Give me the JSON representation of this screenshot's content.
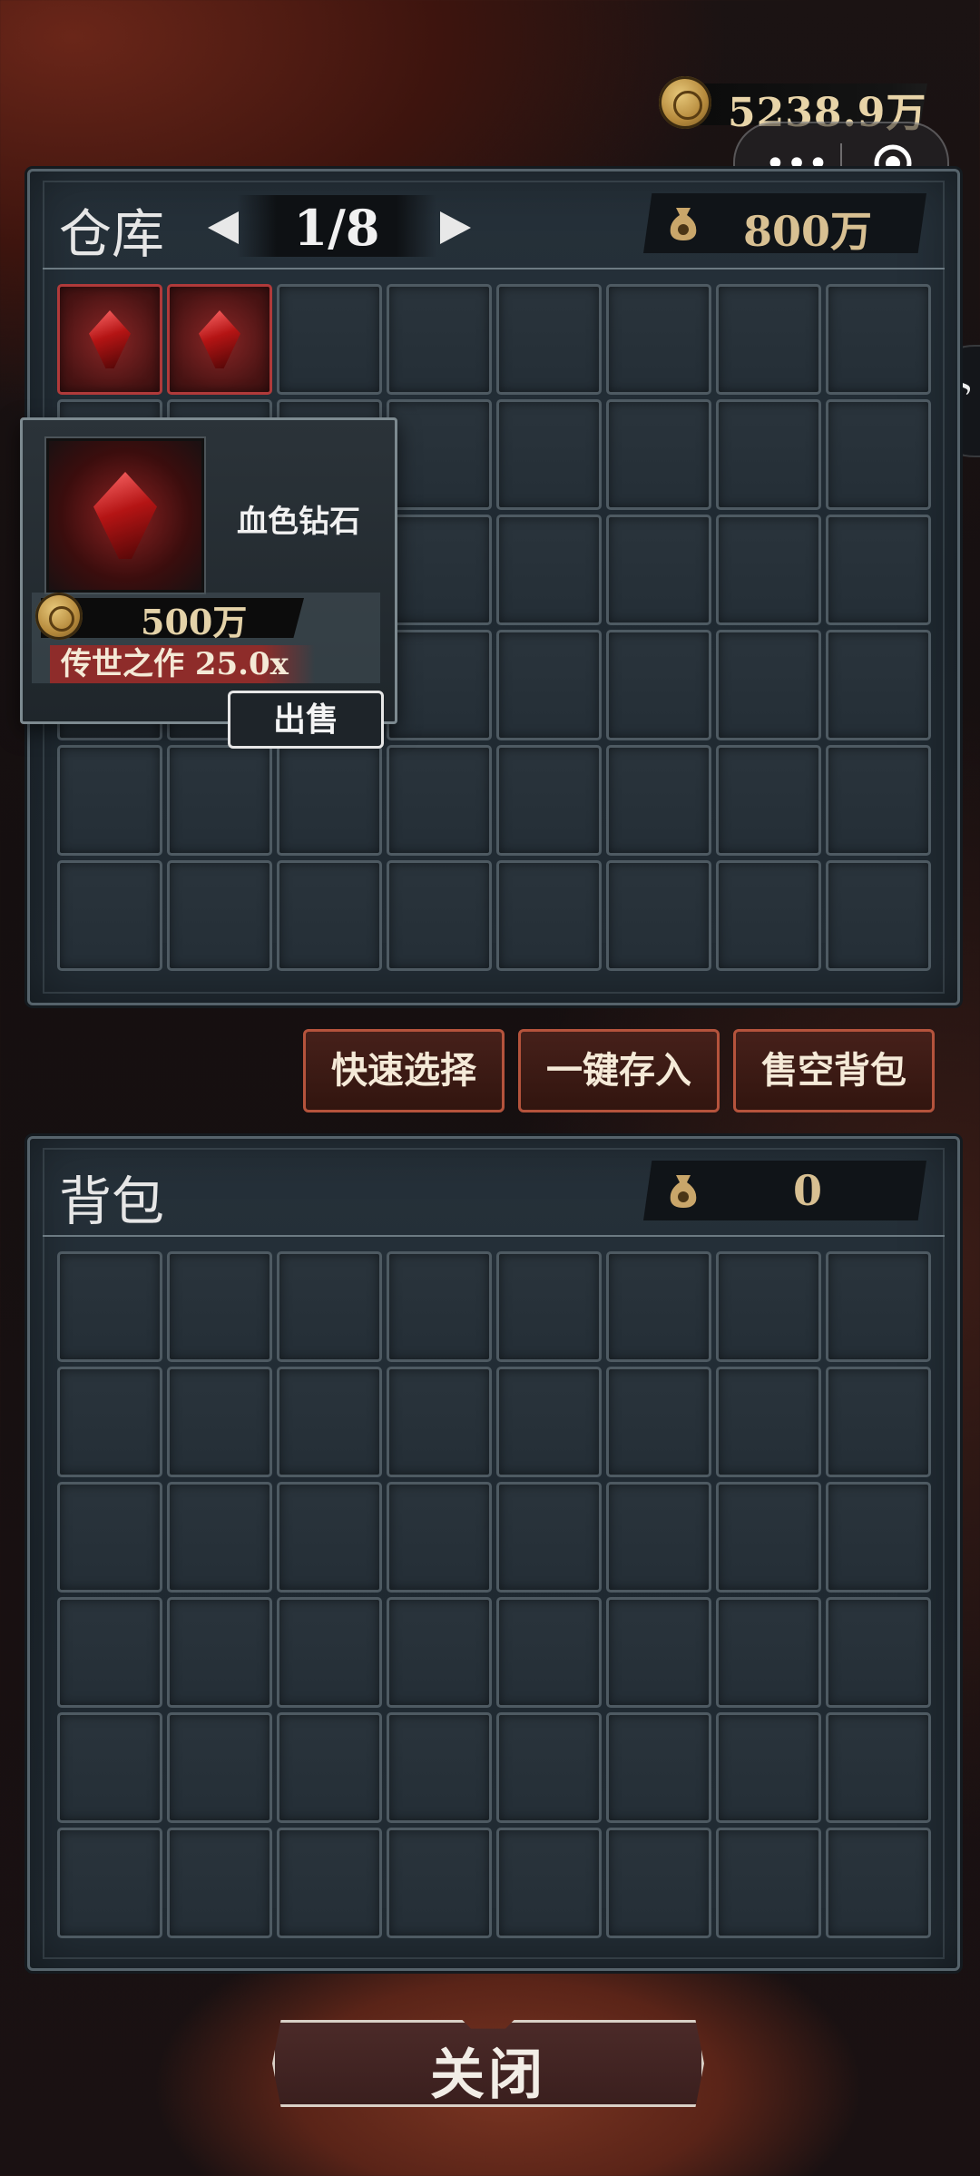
{
  "top_bar": {
    "coins": "5238.9万"
  },
  "capsule": {
    "more_icon": "more-dots-icon",
    "close_icon": "target-icon"
  },
  "warehouse": {
    "title": "仓库",
    "page": "1/8",
    "value": "800万",
    "filled_slots": 2,
    "total_slots": 48
  },
  "tooltip": {
    "item_name": "血色钻石",
    "price": "500万",
    "quality": "传世之作 25.0x",
    "sell_label": "出售"
  },
  "actions": {
    "quick_select": "快速选择",
    "deposit_all": "一键存入",
    "sell_backpack": "售空背包"
  },
  "backpack": {
    "title": "背包",
    "value": "0",
    "total_slots": 48
  },
  "close_label": "关闭",
  "colors": {
    "accent_red": "#b03a3a",
    "gold": "#e2cda0",
    "panel": "#26313a"
  }
}
